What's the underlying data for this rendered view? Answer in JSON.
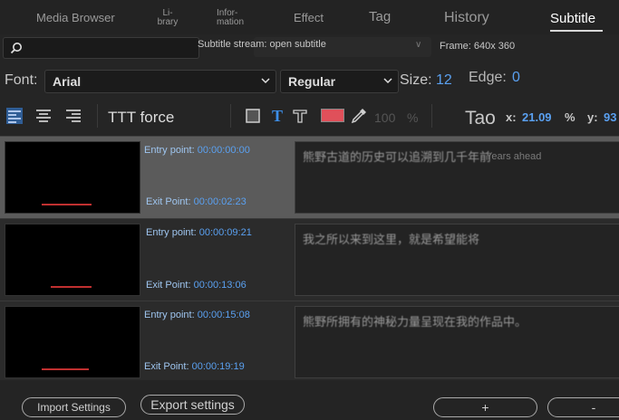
{
  "tabs": [
    {
      "label": "Media Browser",
      "active": false
    },
    {
      "label": "Li-\nbrary",
      "active": false
    },
    {
      "label": "Infor-\nmation",
      "active": false
    },
    {
      "label": "Effect",
      "active": false
    },
    {
      "label": "Tag",
      "active": false
    },
    {
      "label": "History",
      "active": false
    },
    {
      "label": "Subtitle",
      "active": true
    }
  ],
  "toolbar": {
    "search_placeholder": "",
    "stream_label": "Subtitle stream: open subtitle",
    "frame_label": "Frame: 640x 360"
  },
  "font": {
    "label": "Font:",
    "family": "Arial",
    "style": "Regular",
    "size_label": "Size:",
    "size": "12",
    "edge_label": "Edge:",
    "edge": "0"
  },
  "format": {
    "force_label": "TTT force",
    "color": "#e0505a",
    "opacity": "100",
    "opacity_unit": "%",
    "tao": "Tao",
    "x_label": "x:",
    "x": "21.09",
    "x_unit": "%",
    "y_label": "y:",
    "y": "93"
  },
  "subtitles": [
    {
      "entry_label": "Entry point:",
      "entry": "00:00:00:00",
      "exit_label": "Exit Point:",
      "exit": "00:00:02:23",
      "text": "熊野古道的历史可以追溯到几千年前",
      "hint": "Years ahead",
      "selected": true
    },
    {
      "entry_label": "Entry point:",
      "entry": "00:00:09:21",
      "exit_label": "Exit Point:",
      "exit": "00:00:13:06",
      "text": "我之所以来到这里，就是希望能将",
      "hint": "",
      "selected": false
    },
    {
      "entry_label": "Entry point:",
      "entry": "00:00:15:08",
      "exit_label": "Exit Point:",
      "exit": "00:00:19:19",
      "text": "熊野所拥有的神秘力量呈现在我的作品中。",
      "hint": "",
      "selected": false
    }
  ],
  "buttons": {
    "import": "Import Settings",
    "export": "Export settings",
    "add": "+",
    "remove": "-"
  }
}
